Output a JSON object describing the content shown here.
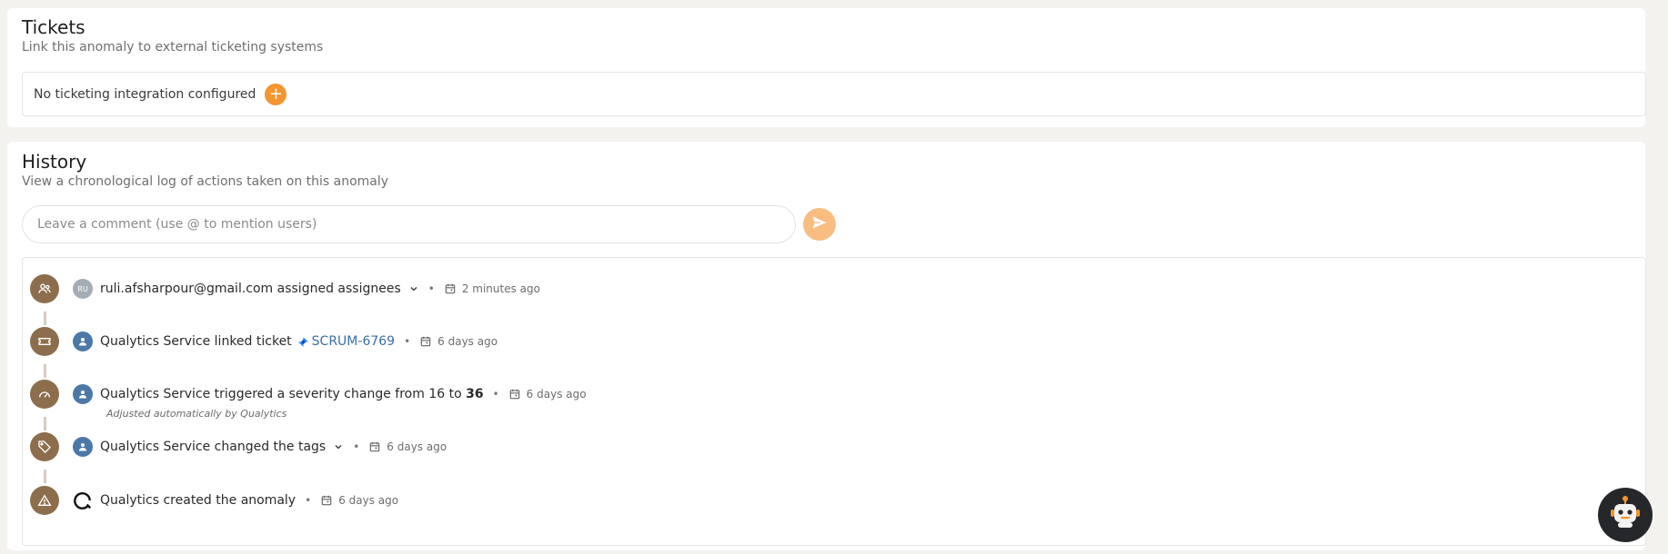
{
  "tickets": {
    "title": "Tickets",
    "subtitle": "Link this anomaly to external ticketing systems",
    "empty_text": "No ticketing integration configured",
    "add_label": "+"
  },
  "history": {
    "title": "History",
    "subtitle": "View a chronological log of actions taken on this anomaly",
    "comment_placeholder": "Leave a comment (use @ to mention users)",
    "events": [
      {
        "icon": "users-icon",
        "avatar": "RU",
        "actor": "ruli.afsharpour@gmail.com",
        "action": "assigned assignees",
        "expandable": true,
        "time": "2 minutes ago"
      },
      {
        "icon": "ticket-icon",
        "actor": "Qualytics Service",
        "action": "linked ticket",
        "ticket": "SCRUM-6769",
        "time": "6 days ago"
      },
      {
        "icon": "gauge-icon",
        "actor": "Qualytics Service",
        "action": "triggered a severity change from",
        "from": "16",
        "to_word": "to",
        "to": "36",
        "note": "Adjusted automatically by Qualytics",
        "time": "6 days ago"
      },
      {
        "icon": "tag-icon",
        "actor": "Qualytics Service",
        "action": "changed the tags",
        "expandable": true,
        "time": "6 days ago"
      },
      {
        "icon": "warning-icon",
        "actor": "Qualytics",
        "action": "created the anomaly",
        "time": "6 days ago"
      }
    ]
  },
  "colors": {
    "accent": "#f4962f",
    "send_disabled": "#f9bd82",
    "timeline_icon": "#8d6e4c",
    "link": "#3b6ea8",
    "page_bg": "#f4f2ef"
  }
}
